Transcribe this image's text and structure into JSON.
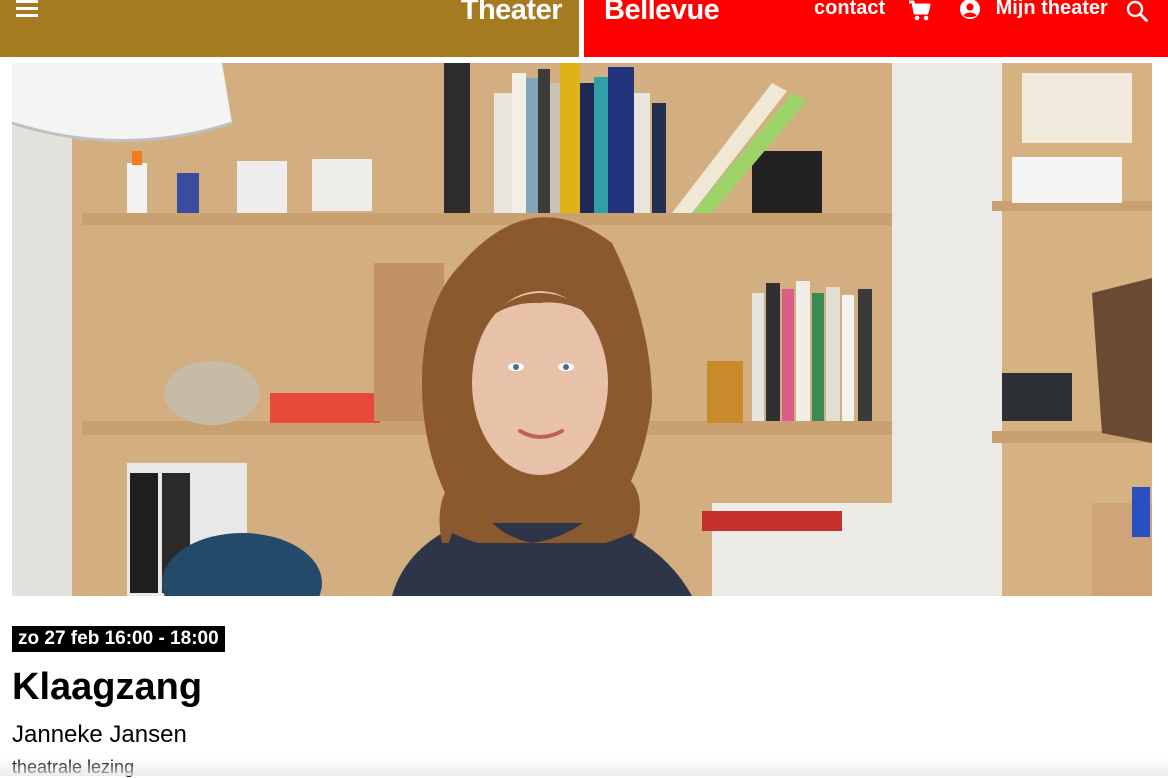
{
  "header": {
    "logo_left": "Theater",
    "logo_right": "Bellevue",
    "menu_icon": "hamburger-icon",
    "contact_label": "contact",
    "cart_icon": "cart-icon",
    "account_label": "Mijn theater",
    "account_icon": "user-circle-icon",
    "search_icon": "search-icon"
  },
  "event": {
    "date_time": "zo 27 feb 16:00 - 18:00",
    "title": "Klaagzang",
    "artist": "Janneke Jansen",
    "genre": "theatrale lezing"
  },
  "colors": {
    "brand_gold": "#a57b22",
    "brand_red": "#ff0000"
  }
}
